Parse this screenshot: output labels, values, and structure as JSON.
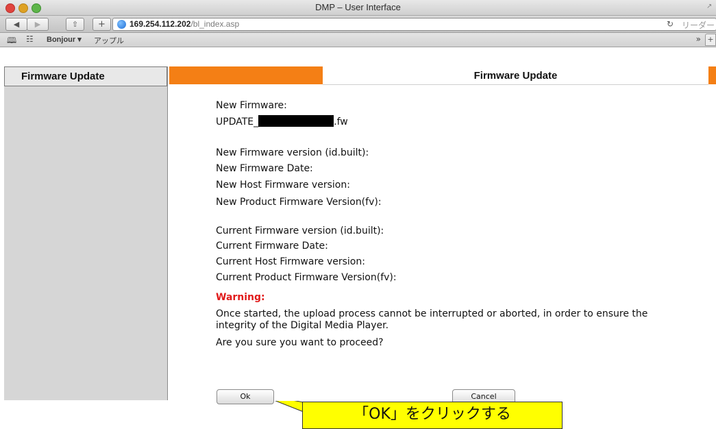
{
  "window": {
    "title": "DMP – User Interface"
  },
  "toolbar": {
    "back_icon": "◀",
    "forward_icon": "▶",
    "share_icon": "⇧",
    "newtab_icon": "+",
    "url_host": "169.254.112.202",
    "url_path": "/bl_index.asp",
    "reload_icon": "↻",
    "reader_label": "リーダー"
  },
  "bookmarks": {
    "book_icon": "📖",
    "grid_icon": "☷",
    "items": [
      "Bonjour ▾",
      "アップル"
    ],
    "more_icon": "»",
    "plus_label": "+"
  },
  "sidebar": {
    "title": "Firmware Update"
  },
  "main": {
    "title": "Firmware Update",
    "new_firmware_label": "New Firmware:",
    "file_prefix": "UPDATE_",
    "file_suffix": ".fw",
    "new_fields": [
      "New Firmware version (id.built):",
      "New Firmware Date:",
      "New Host Firmware version:",
      "New Product Firmware Version(fv):"
    ],
    "current_fields": [
      "Current Firmware version (id.built):",
      "Current Firmware Date:",
      "Current Host Firmware version:",
      "Current Product Firmware Version(fv):"
    ],
    "warning_label": "Warning:",
    "warning_text_1": "Once started, the upload process cannot be interrupted or aborted, in order to ensure the",
    "warning_text_2": "integrity of the Digital Media Player.",
    "question": "Are you sure you want to proceed?",
    "ok_label": "Ok",
    "cancel_label": "Cancel"
  },
  "annotation": {
    "text": "「OK」をクリックする",
    "color": "#ffff00"
  },
  "colors": {
    "accent_orange": "#f47f15",
    "warning_red": "#e11b1b"
  }
}
